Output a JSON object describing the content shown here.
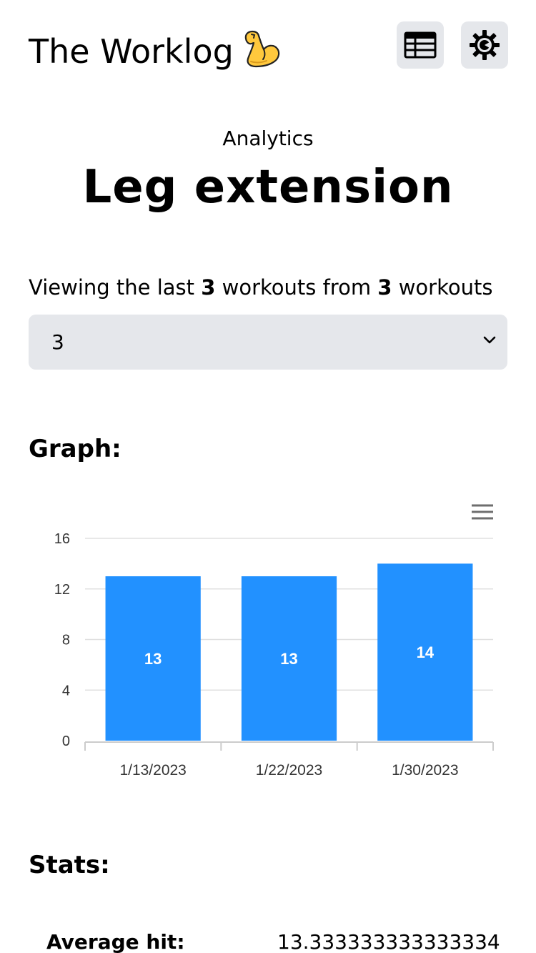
{
  "header": {
    "app_title": "The Worklog",
    "table_button_icon": "table-icon",
    "settings_button_icon": "gear-icon"
  },
  "page": {
    "subtitle": "Analytics",
    "title": "Leg extension"
  },
  "viewing": {
    "prefix": "Viewing the last",
    "count_shown": "3",
    "middle": "workouts from",
    "count_total": "3",
    "suffix": "workouts"
  },
  "select": {
    "value": "3"
  },
  "sections": {
    "graph": "Graph:",
    "stats": "Stats:"
  },
  "chart_data": {
    "type": "bar",
    "categories": [
      "1/13/2023",
      "1/22/2023",
      "1/30/2023"
    ],
    "values": [
      13,
      13,
      14
    ],
    "data_labels": [
      "13",
      "13",
      "14"
    ],
    "ylim": [
      0,
      16
    ],
    "yticks": [
      0,
      4,
      8,
      12,
      16
    ],
    "grid": true,
    "bar_color": "#2291FF",
    "menu_icon": "hamburger-menu-icon"
  },
  "stats": {
    "average_label": "Average hit:",
    "average_value": "13.333333333333334"
  },
  "colors": {
    "button_bg": "#e5e7eb",
    "bar": "#2291FF",
    "emoji_arm": "#FFC83D"
  }
}
